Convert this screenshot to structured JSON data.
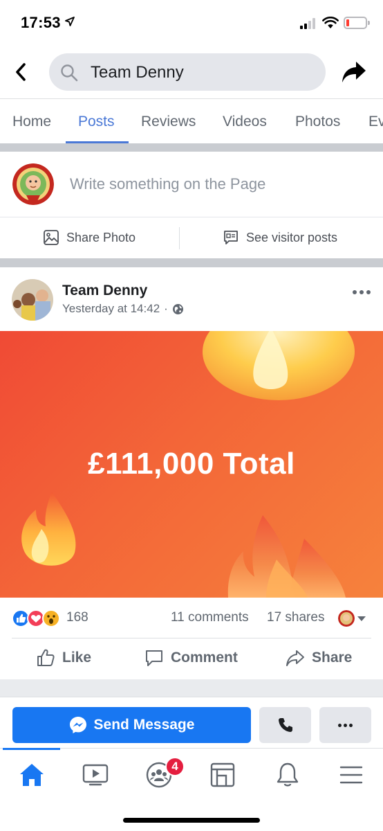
{
  "status_bar": {
    "time": "17:53",
    "battery_color": "#ff3b30"
  },
  "header": {
    "search_text": "Team Denny",
    "icons": [
      "chevron-left-icon",
      "search-icon",
      "share-arrow-icon"
    ]
  },
  "tabs": [
    {
      "label": "Home",
      "active": false
    },
    {
      "label": "Posts",
      "active": true
    },
    {
      "label": "Reviews",
      "active": false
    },
    {
      "label": "Videos",
      "active": false
    },
    {
      "label": "Photos",
      "active": false
    },
    {
      "label": "Ev",
      "active": false
    }
  ],
  "composer": {
    "placeholder": "Write something on the Page",
    "share_photo_label": "Share Photo",
    "visitor_posts_label": "See visitor posts"
  },
  "post": {
    "author": "Team Denny",
    "timestamp": "Yesterday at 14:42",
    "separator": "·",
    "privacy_icon": "globe-icon",
    "image_text": "£111,000 Total",
    "image_colors": [
      "#f04a35",
      "#f6823c"
    ],
    "reactions": {
      "types": [
        "like",
        "love",
        "wow"
      ],
      "count": "168"
    },
    "comments_label": "11 comments",
    "shares_label": "17 shares",
    "actions": {
      "like": "Like",
      "comment": "Comment",
      "share": "Share"
    }
  },
  "bottom": {
    "send_message_label": "Send Message",
    "accent": "#1877f2"
  },
  "tabbar": {
    "items": [
      "home-icon",
      "watch-icon",
      "groups-icon",
      "pages-icon",
      "bell-icon",
      "menu-icon"
    ],
    "groups_badge": "4"
  }
}
